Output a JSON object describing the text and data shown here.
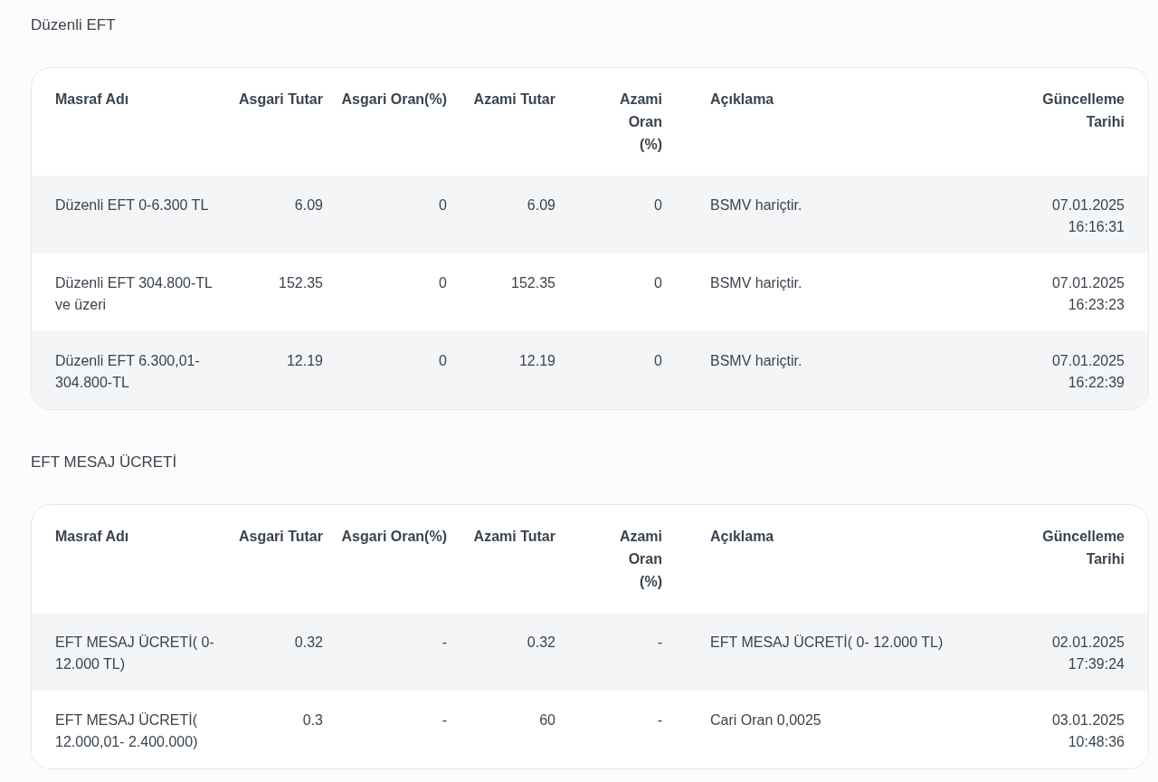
{
  "sections": [
    {
      "title": "Düzenli EFT",
      "columns": [
        "Masraf Adı",
        "Asgari Tutar",
        "Asgari Oran(%)",
        "Azami Tutar",
        "Azami Oran (%)",
        "Açıklama",
        "Güncelleme Tarihi"
      ],
      "rows": [
        [
          "Düzenli EFT 0-6.300 TL",
          "6.09",
          "0",
          "6.09",
          "0",
          "BSMV hariçtir.",
          "07.01.2025 16:16:31"
        ],
        [
          "Düzenli EFT 304.800-TL ve üzeri",
          "152.35",
          "0",
          "152.35",
          "0",
          "BSMV hariçtir.",
          "07.01.2025 16:23:23"
        ],
        [
          "Düzenli EFT 6.300,01-304.800-TL",
          "12.19",
          "0",
          "12.19",
          "0",
          "BSMV hariçtir.",
          "07.01.2025 16:22:39"
        ]
      ]
    },
    {
      "title": "EFT MESAJ ÜCRETİ",
      "columns": [
        "Masraf Adı",
        "Asgari Tutar",
        "Asgari Oran(%)",
        "Azami Tutar",
        "Azami Oran (%)",
        "Açıklama",
        "Güncelleme Tarihi"
      ],
      "rows": [
        [
          "EFT MESAJ ÜCRETİ( 0- 12.000 TL)",
          "0.32",
          "-",
          "0.32",
          "-",
          "EFT MESAJ ÜCRETİ( 0- 12.000 TL)",
          "02.01.2025 17:39:24"
        ],
        [
          "EFT MESAJ ÜCRETİ( 12.000,01- 2.400.000)",
          "0.3",
          "-",
          "60",
          "-",
          "Cari Oran 0,0025",
          "03.01.2025 10:48:36"
        ]
      ]
    }
  ]
}
